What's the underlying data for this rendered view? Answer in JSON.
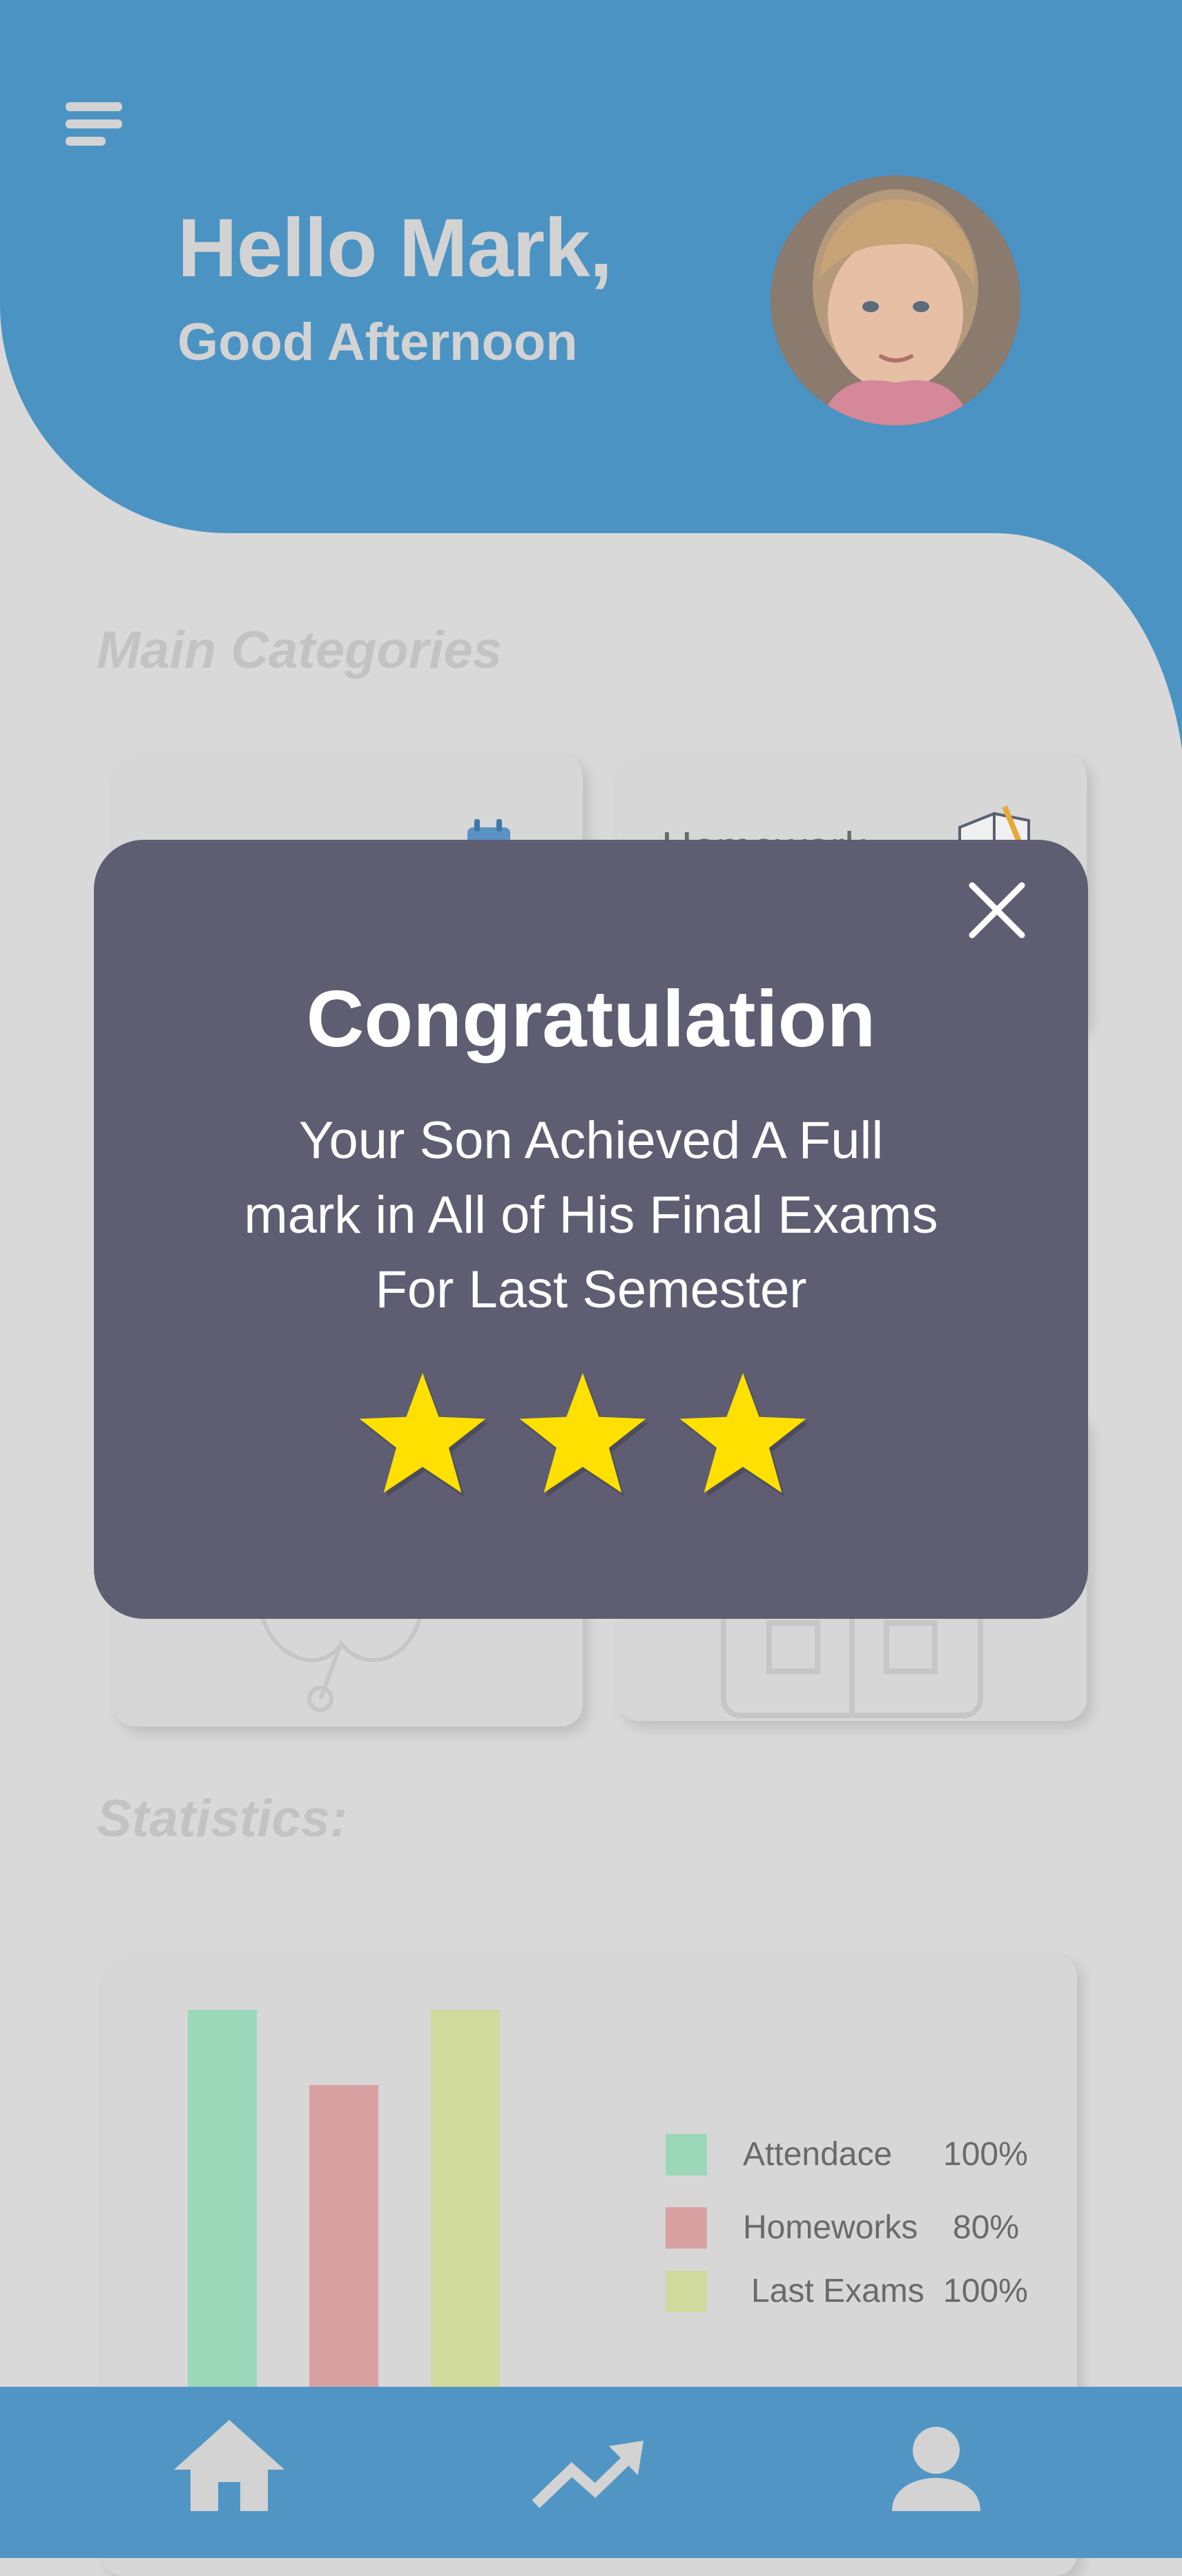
{
  "header": {
    "greeting": "Hello Mark,",
    "subgreeting": "Good Afternoon",
    "menu_icon": "hamburger-menu-icon",
    "avatar_alt": "child profile photo"
  },
  "sections": {
    "main_categories": "Main Categories",
    "statistics": "Statistics:"
  },
  "categories": [
    {
      "label": "",
      "icon": "calendar-icon"
    },
    {
      "label": "Homework",
      "icon": "notebook-icon"
    },
    {
      "label": "",
      "icon": "stethoscope-icon"
    },
    {
      "label": "",
      "icon": "book-icon"
    }
  ],
  "chart_data": {
    "type": "bar",
    "categories": [
      "Attendace",
      "Homeworks",
      "Last Exams"
    ],
    "values": [
      100,
      80,
      100
    ],
    "ylim": [
      0,
      100
    ],
    "colors": [
      "#9ad8b9",
      "#d9a0a1",
      "#d0da9d"
    ],
    "legend": [
      {
        "name": "Attendace",
        "percent": "100%"
      },
      {
        "name": "Homeworks",
        "percent": "80%"
      },
      {
        "name": "Last Exams",
        "percent": "100%"
      }
    ],
    "legend_position": "right"
  },
  "modal": {
    "title": "Congratulation",
    "message_lines": [
      "Your Son Achieved A Full",
      "mark in All of His Final Exams",
      "For Last Semester"
    ],
    "stars": 3,
    "close_icon": "close-icon",
    "star_color": "#ffe000"
  },
  "nav": {
    "items": [
      {
        "icon": "home-icon"
      },
      {
        "icon": "trending-up-icon"
      },
      {
        "icon": "person-icon"
      }
    ]
  },
  "colors": {
    "header_blue": "#4b93c3",
    "nav_blue": "#5195c4",
    "modal_bg": "#5e5d72",
    "page_bg": "#d9d9d9"
  }
}
